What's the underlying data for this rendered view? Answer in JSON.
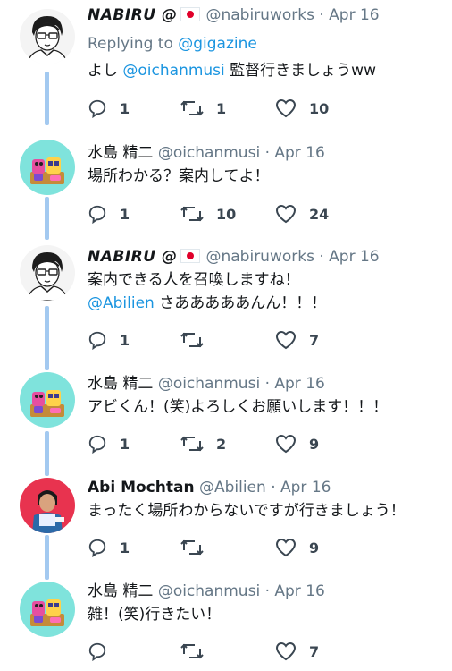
{
  "tweets": [
    {
      "name": "NABIRU @",
      "handle": "@nabiruworks",
      "date": "Apr 16",
      "reply_prefix": "Replying to",
      "reply_to": "@gigazine",
      "text_pre": "よし",
      "mention": "@oichanmusi",
      "text_post": "監督行きましょうww",
      "replies": "1",
      "retweets": "1",
      "likes": "10"
    },
    {
      "name": "水島 精二",
      "handle": "@oichanmusi",
      "date": "Apr 16",
      "text": "場所わかる？案内してよ！",
      "replies": "1",
      "retweets": "10",
      "likes": "24"
    },
    {
      "name": "NABIRU @",
      "handle": "@nabiruworks",
      "date": "Apr 16",
      "text_line1": "案内できる人を召喚しますね！",
      "mention": "@Abilien",
      "text_line2_post": "さあああああんん！！！",
      "replies": "1",
      "retweets": "",
      "likes": "7"
    },
    {
      "name": "水島 精二",
      "handle": "@oichanmusi",
      "date": "Apr 16",
      "text": "アビくん！(笑)よろしくお願いします！！！",
      "replies": "1",
      "retweets": "2",
      "likes": "9"
    },
    {
      "name": "Abi Mochtan",
      "handle": "@Abilien",
      "date": "Apr 16",
      "text": "まったく場所わからないですが行きましょう！",
      "replies": "1",
      "retweets": "",
      "likes": "9"
    },
    {
      "name": "水島 精二",
      "handle": "@oichanmusi",
      "date": "Apr 16",
      "text": "雑！(笑)行きたい！",
      "replies": "",
      "retweets": "",
      "likes": "7"
    }
  ],
  "separator": "·",
  "colors": {
    "link": "#1b95e0",
    "thread_line": "#a3c9f0",
    "meta": "#657786"
  },
  "icons": [
    "reply-icon",
    "retweet-icon",
    "like-icon",
    "japan-flag-icon"
  ]
}
